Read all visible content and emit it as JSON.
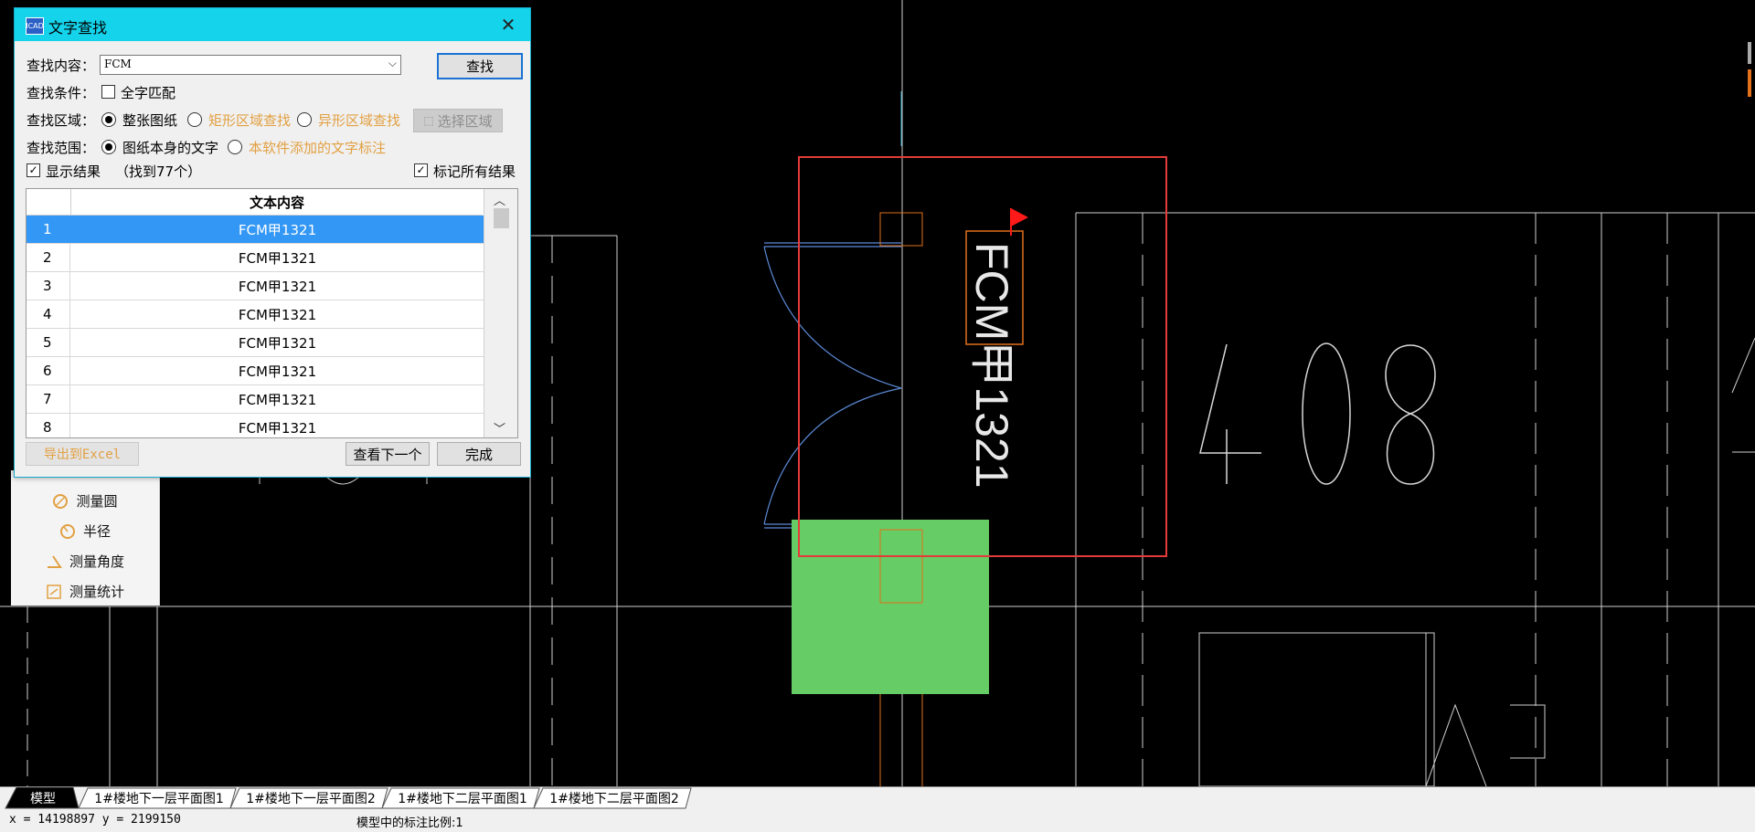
{
  "dialog": {
    "title": "文字查找",
    "title_icon_text": "ICAD",
    "labels": {
      "content": "查找内容：",
      "condition": "查找条件：",
      "area": "查找区域：",
      "scope": "查找范围："
    },
    "search_value": "FCM",
    "find_button": "查找",
    "full_match": {
      "label": "全字匹配",
      "checked": false
    },
    "area_options": [
      {
        "label": "整张图纸",
        "selected": true
      },
      {
        "label": "矩形区域查找",
        "selected": false
      },
      {
        "label": "异形区域查找",
        "selected": false
      }
    ],
    "select_area_button": "选择区域",
    "scope_options": [
      {
        "label": "图纸本身的文字",
        "selected": true
      },
      {
        "label": "本软件添加的文字标注",
        "selected": false
      }
    ],
    "show_results": {
      "label": "显示结果",
      "checked": true
    },
    "found_count": "（找到77个）",
    "mark_all": {
      "label": "标记所有结果",
      "checked": true
    },
    "table": {
      "header": "文本内容",
      "rows": [
        {
          "num": "1",
          "text": "FCM甲1321",
          "selected": true
        },
        {
          "num": "2",
          "text": "FCM甲1321",
          "selected": false
        },
        {
          "num": "3",
          "text": "FCM甲1321",
          "selected": false
        },
        {
          "num": "4",
          "text": "FCM甲1321",
          "selected": false
        },
        {
          "num": "5",
          "text": "FCM甲1321",
          "selected": false
        },
        {
          "num": "6",
          "text": "FCM甲1321",
          "selected": false
        },
        {
          "num": "7",
          "text": "FCM甲1321",
          "selected": false
        },
        {
          "num": "8",
          "text": "FCM甲1321",
          "selected": false
        }
      ]
    },
    "export_button": "导出到Excel",
    "next_button": "查看下一个",
    "done_button": "完成"
  },
  "measure_tools": [
    {
      "label": "测量圆",
      "icon": "circle-measure-icon"
    },
    {
      "label": "半径",
      "icon": "radius-icon"
    },
    {
      "label": "测量角度",
      "icon": "angle-icon"
    },
    {
      "label": "测量统计",
      "icon": "statistics-icon"
    }
  ],
  "canvas": {
    "room_number": "408",
    "door_label": "FCM甲1321",
    "colors": {
      "highlight_box": "#e43a3a",
      "match_box": "#e1711a",
      "flag": "#ff1a1a",
      "green_block": "#66cc66",
      "lines": "#cfcfcf",
      "door_arc": "#5b8ad6"
    }
  },
  "tabs": [
    {
      "label": "模型",
      "active": true
    },
    {
      "label": "1#楼地下一层平面图1",
      "active": false
    },
    {
      "label": "1#楼地下一层平面图2",
      "active": false
    },
    {
      "label": "1#楼地下二层平面图1",
      "active": false
    },
    {
      "label": "1#楼地下二层平面图2",
      "active": false
    }
  ],
  "status": {
    "coords": "x = 14198897  y = 2199150",
    "scale": "模型中的标注比例:1"
  }
}
